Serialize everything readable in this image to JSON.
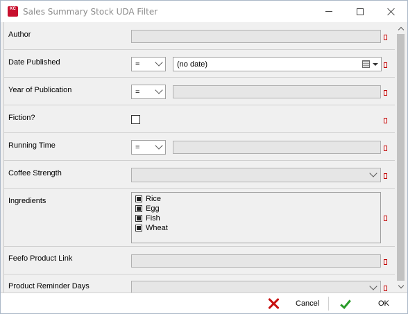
{
  "window": {
    "title": "Sales Summary Stock UDA Filter",
    "app_icon_text": "KC",
    "accent_color": "#c8102e"
  },
  "fields": [
    {
      "label": "Author",
      "value": ""
    },
    {
      "label": "Date Published",
      "operator": "=",
      "date_value": "(no date)"
    },
    {
      "label": "Year of Publication",
      "operator": "=",
      "value": ""
    },
    {
      "label": "Fiction?",
      "checked": false
    },
    {
      "label": "Running Time",
      "operator": "=",
      "value": ""
    },
    {
      "label": "Coffee Strength",
      "selected": ""
    },
    {
      "label": "Ingredients",
      "items": [
        "Rice",
        "Egg",
        "Fish",
        "Wheat"
      ]
    },
    {
      "label": "Feefo Product Link",
      "value": ""
    },
    {
      "label": "Product Reminder Days",
      "selected": ""
    }
  ],
  "footer": {
    "cancel_label": "Cancel",
    "ok_label": "OK",
    "cancel_color": "#c81010",
    "ok_color": "#2a9c2a"
  }
}
